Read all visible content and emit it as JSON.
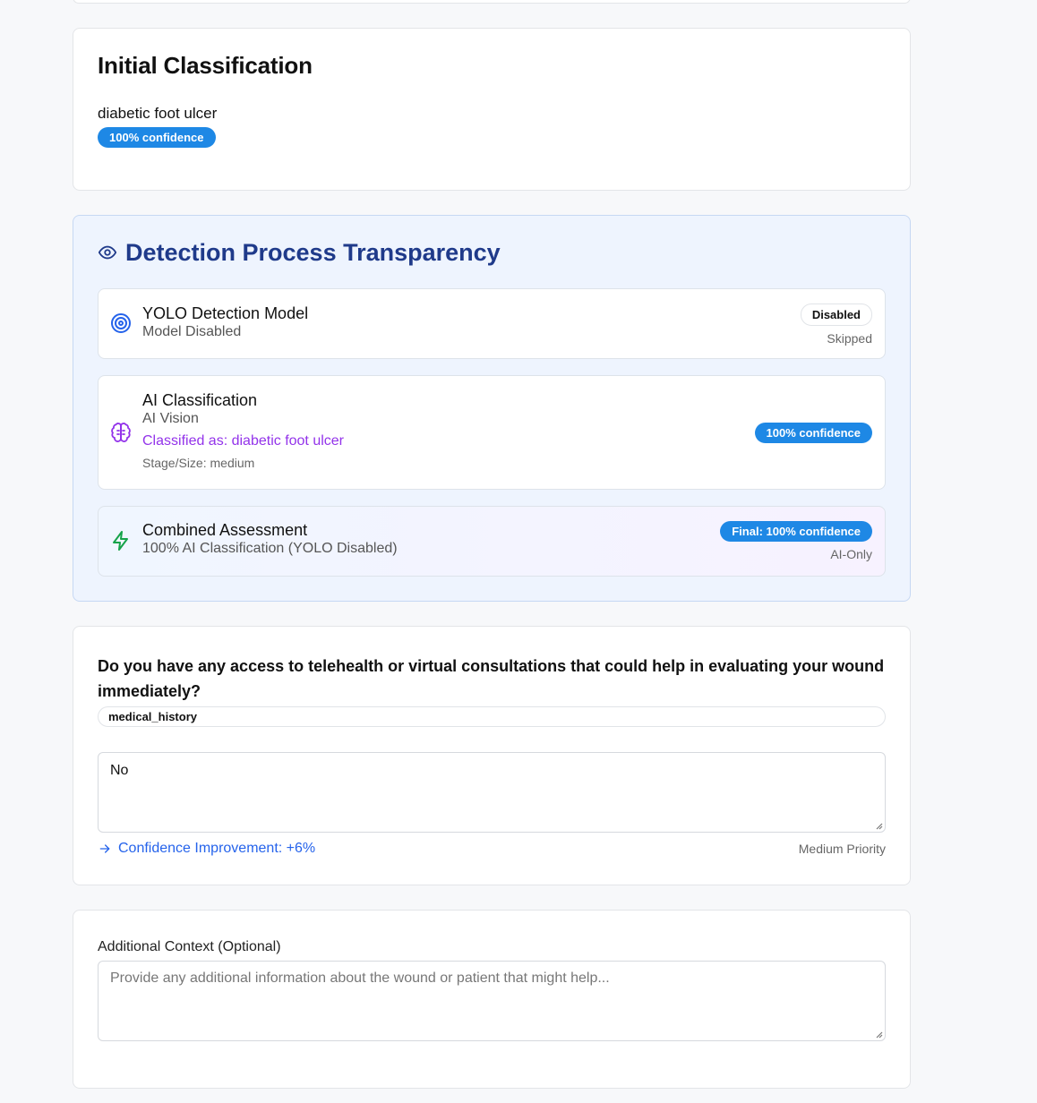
{
  "initial": {
    "title": "Initial Classification",
    "classification": "diabetic foot ulcer",
    "confidence": "100% confidence"
  },
  "detection": {
    "title": "Detection Process Transparency",
    "yolo": {
      "title": "YOLO Detection Model",
      "subtitle": "Model Disabled",
      "badge": "Disabled",
      "status": "Skipped"
    },
    "ai": {
      "title": "AI Classification",
      "subtitle": "AI Vision",
      "classified": "Classified as: diabetic foot ulcer",
      "stage": "Stage/Size: medium",
      "confidence": "100% confidence"
    },
    "combined": {
      "title": "Combined Assessment",
      "subtitle": "100% AI Classification (YOLO Disabled)",
      "badge": "Final: 100% confidence",
      "mode": "AI-Only"
    }
  },
  "question": {
    "text": "Do you have any access to telehealth or virtual consultations that could help in evaluating your wound immediately?",
    "category": "medical_history",
    "answer": "No",
    "improvement": "Confidence Improvement: +6%",
    "priority": "Medium Priority"
  },
  "context": {
    "label": "Additional Context (Optional)",
    "placeholder": "Provide any additional information about the wound or patient that might help..."
  },
  "colors": {
    "primary_badge": "#1e88e5",
    "heading_blue": "#1f3a8a",
    "purple": "#9333ea",
    "green": "#16a34a",
    "link_blue": "#2563eb"
  },
  "icons": {
    "detection": "eye-icon",
    "yolo": "target-icon",
    "ai": "brain-icon",
    "combined": "zap-icon",
    "improvement": "arrow-right-icon"
  }
}
